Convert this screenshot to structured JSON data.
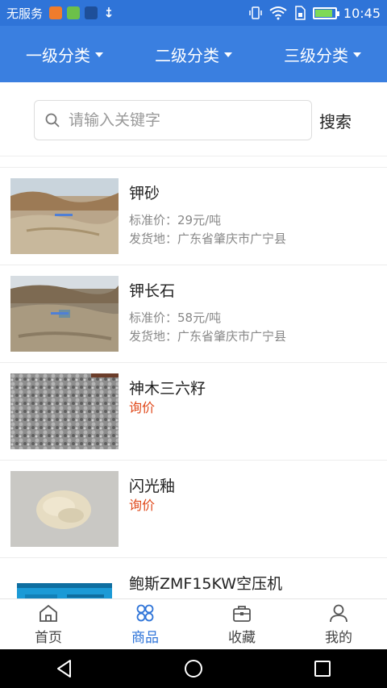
{
  "statusbar": {
    "carrier": "无服务",
    "time": "10:45",
    "icons": [
      "weibo-icon",
      "wechat-icon",
      "uc-icon",
      "usb-icon",
      "vibrate-icon",
      "wifi-icon",
      "sim-icon",
      "battery-icon"
    ]
  },
  "categories": [
    {
      "label": "一级分类"
    },
    {
      "label": "二级分类"
    },
    {
      "label": "三级分类"
    }
  ],
  "search": {
    "placeholder": "请输入关键字",
    "button_label": "搜索"
  },
  "products": [
    {
      "name": "钾砂",
      "price": "标准价：29元/吨",
      "origin": "发货地：广东省肇庆市广宁县"
    },
    {
      "name": "钾长石",
      "price": "标准价：58元/吨",
      "origin": "发货地：广东省肇庆市广宁县"
    },
    {
      "name": "神木三六籽",
      "inquire": "询价"
    },
    {
      "name": "闪光釉",
      "inquire": "询价"
    },
    {
      "name": "鲍斯ZMF15KW空压机"
    }
  ],
  "tabs": [
    {
      "label": "首页",
      "icon": "home-icon"
    },
    {
      "label": "商品",
      "icon": "grid-icon",
      "active": true
    },
    {
      "label": "收藏",
      "icon": "briefcase-icon"
    },
    {
      "label": "我的",
      "icon": "user-icon"
    }
  ],
  "colors": {
    "primary": "#3a7fe0",
    "status_bar": "#2f74d8",
    "inquire_text": "#e04a1c",
    "active_tab": "#2f74d8"
  }
}
